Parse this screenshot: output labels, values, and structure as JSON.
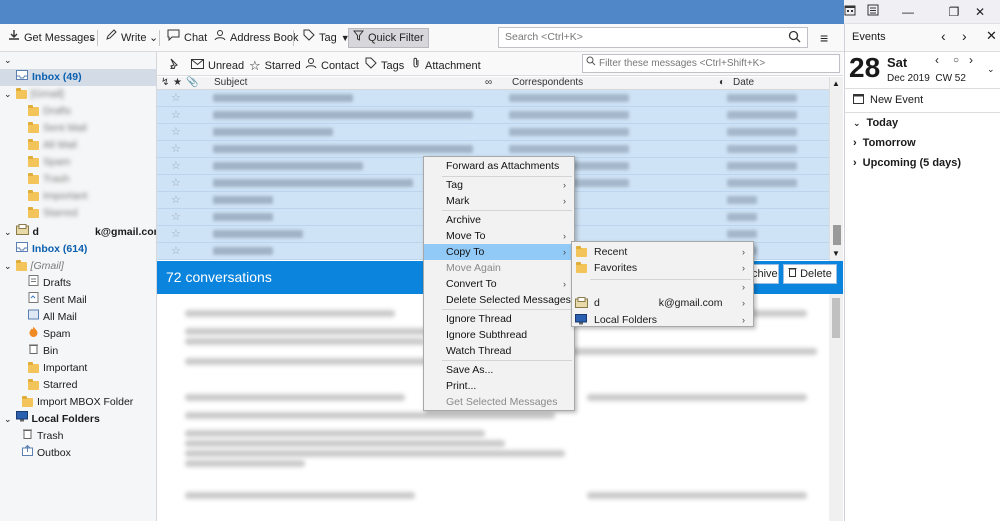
{
  "toolbar": {
    "get_messages": "Get Messages",
    "write": "Write",
    "chat": "Chat",
    "address_book": "Address Book",
    "tag": "Tag",
    "quick_filter": "Quick Filter",
    "search_placeholder": "Search <Ctrl+K>"
  },
  "quick_filter_bar": {
    "unread": "Unread",
    "starred": "Starred",
    "contact": "Contact",
    "tags": "Tags",
    "attachment": "Attachment",
    "filter_placeholder": "Filter these messages <Ctrl+Shift+K>"
  },
  "thread_columns": {
    "subject": "Subject",
    "correspondents": "Correspondents",
    "date": "Date"
  },
  "folders": {
    "inbox_top": "Inbox (49)",
    "gmail_blurred": "[Gmail]",
    "blurred_children": [
      "Drafts",
      "Sent Mail",
      "All Mail",
      "Spam",
      "Trash",
      "Important",
      "Starred"
    ],
    "account_prefix": "d",
    "account_email": "k@gmail.com",
    "inbox": "Inbox (614)",
    "gmail": "[Gmail]",
    "gmail_children": [
      "Drafts",
      "Sent Mail",
      "All Mail",
      "Spam",
      "Bin",
      "Important",
      "Starred"
    ],
    "import_mbox": "Import MBOX Folder",
    "local_folders": "Local Folders",
    "local_children": [
      "Trash",
      "Outbox"
    ]
  },
  "conversation": {
    "count_label": "72 conversations",
    "archive_label": "chive",
    "delete_label": "Delete"
  },
  "context_menu": {
    "items": [
      {
        "label": "Forward as Attachments",
        "submenu": false,
        "disabled": false
      },
      {
        "label": "Tag",
        "submenu": true,
        "disabled": false
      },
      {
        "label": "Mark",
        "submenu": true,
        "disabled": false
      },
      {
        "label": "Archive",
        "submenu": false,
        "disabled": false
      },
      {
        "label": "Move To",
        "submenu": true,
        "disabled": false
      },
      {
        "label": "Copy To",
        "submenu": true,
        "disabled": false,
        "highlighted": true
      },
      {
        "label": "Move Again",
        "submenu": false,
        "disabled": true
      },
      {
        "label": "Convert To",
        "submenu": true,
        "disabled": false
      },
      {
        "label": "Delete Selected Messages",
        "submenu": false,
        "disabled": false
      },
      {
        "label": "Ignore Thread",
        "submenu": false,
        "disabled": false
      },
      {
        "label": "Ignore Subthread",
        "submenu": false,
        "disabled": false
      },
      {
        "label": "Watch Thread",
        "submenu": false,
        "disabled": false
      },
      {
        "label": "Save As...",
        "submenu": false,
        "disabled": false
      },
      {
        "label": "Print...",
        "submenu": false,
        "disabled": false
      },
      {
        "label": "Get Selected Messages",
        "submenu": false,
        "disabled": true
      }
    ]
  },
  "copy_to_submenu": {
    "recent": "Recent",
    "favorites": "Favorites",
    "account_prefix": "d",
    "account_email": "k@gmail.com",
    "local_folders": "Local Folders"
  },
  "events": {
    "title": "Events",
    "day_number": "28",
    "weekday": "Sat",
    "month_year_week": "Dec 2019  CW 52",
    "new_event": "New Event",
    "today": "Today",
    "tomorrow": "Tomorrow",
    "upcoming": "Upcoming (5 days)"
  },
  "colors": {
    "accent_blue": "#0a84dc",
    "selection": "#cfe3f6",
    "menu_highlight": "#91c9f7",
    "title_accent": "#4f87c9"
  }
}
